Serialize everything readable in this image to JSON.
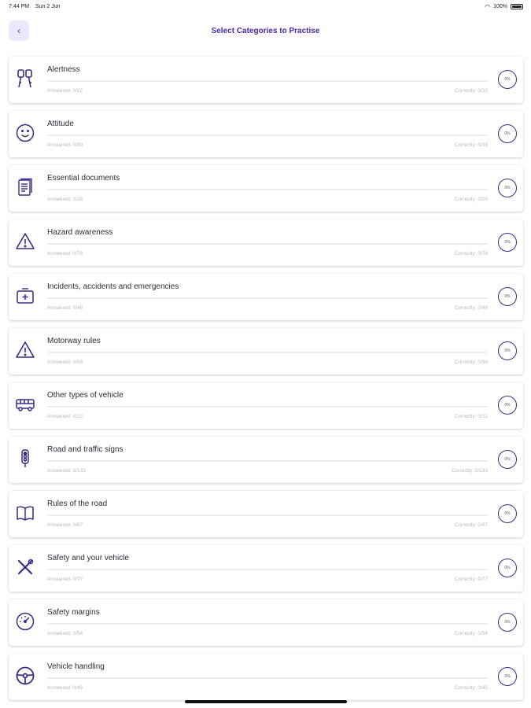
{
  "status_bar": {
    "time": "7:44 PM",
    "date": "Sun 2 Jun",
    "battery": "100%"
  },
  "header": {
    "title": "Select Categories to Practise"
  },
  "theme": {
    "accent": "#4b2aa3",
    "icon_color": "#3d2a8a"
  },
  "categories": [
    {
      "title": "Alertness",
      "answered": "Answered: 0/22",
      "correct": "Correctly: 0/22",
      "percent": "0%",
      "icon": "car-keys-icon"
    },
    {
      "title": "Attitude",
      "answered": "Answered: 0/39",
      "correct": "Correctly: 0/39",
      "percent": "0%",
      "icon": "smiley-icon"
    },
    {
      "title": "Essential documents",
      "answered": "Answered: 0/26",
      "correct": "Correctly: 0/26",
      "percent": "0%",
      "icon": "documents-icon"
    },
    {
      "title": "Hazard awareness",
      "answered": "Answered: 0/78",
      "correct": "Correctly: 0/78",
      "percent": "0%",
      "icon": "warning-icon"
    },
    {
      "title": "Incidents, accidents and emergencies",
      "answered": "Answered: 0/48",
      "correct": "Correctly: 0/48",
      "percent": "0%",
      "icon": "first-aid-icon"
    },
    {
      "title": "Motorway rules",
      "answered": "Answered: 0/56",
      "correct": "Correctly: 0/56",
      "percent": "0%",
      "icon": "warning-icon"
    },
    {
      "title": "Other types of vehicle",
      "answered": "Answered: 0/22",
      "correct": "Correctly: 0/22",
      "percent": "0%",
      "icon": "bus-icon"
    },
    {
      "title": "Road and traffic signs",
      "answered": "Answered: 0/133",
      "correct": "Correctly: 0/133",
      "percent": "0%",
      "icon": "traffic-light-icon"
    },
    {
      "title": "Rules of the road",
      "answered": "Answered: 0/67",
      "correct": "Correctly: 0/67",
      "percent": "0%",
      "icon": "book-icon"
    },
    {
      "title": "Safety and your vehicle",
      "answered": "Answered: 0/77",
      "correct": "Correctly: 0/77",
      "percent": "0%",
      "icon": "tools-icon"
    },
    {
      "title": "Safety margins",
      "answered": "Answered: 0/54",
      "correct": "Correctly: 0/54",
      "percent": "0%",
      "icon": "speedometer-icon"
    },
    {
      "title": "Vehicle handling",
      "answered": "Answered: 0/45",
      "correct": "Correctly: 0/45",
      "percent": "0%",
      "icon": "steering-wheel-icon"
    }
  ]
}
